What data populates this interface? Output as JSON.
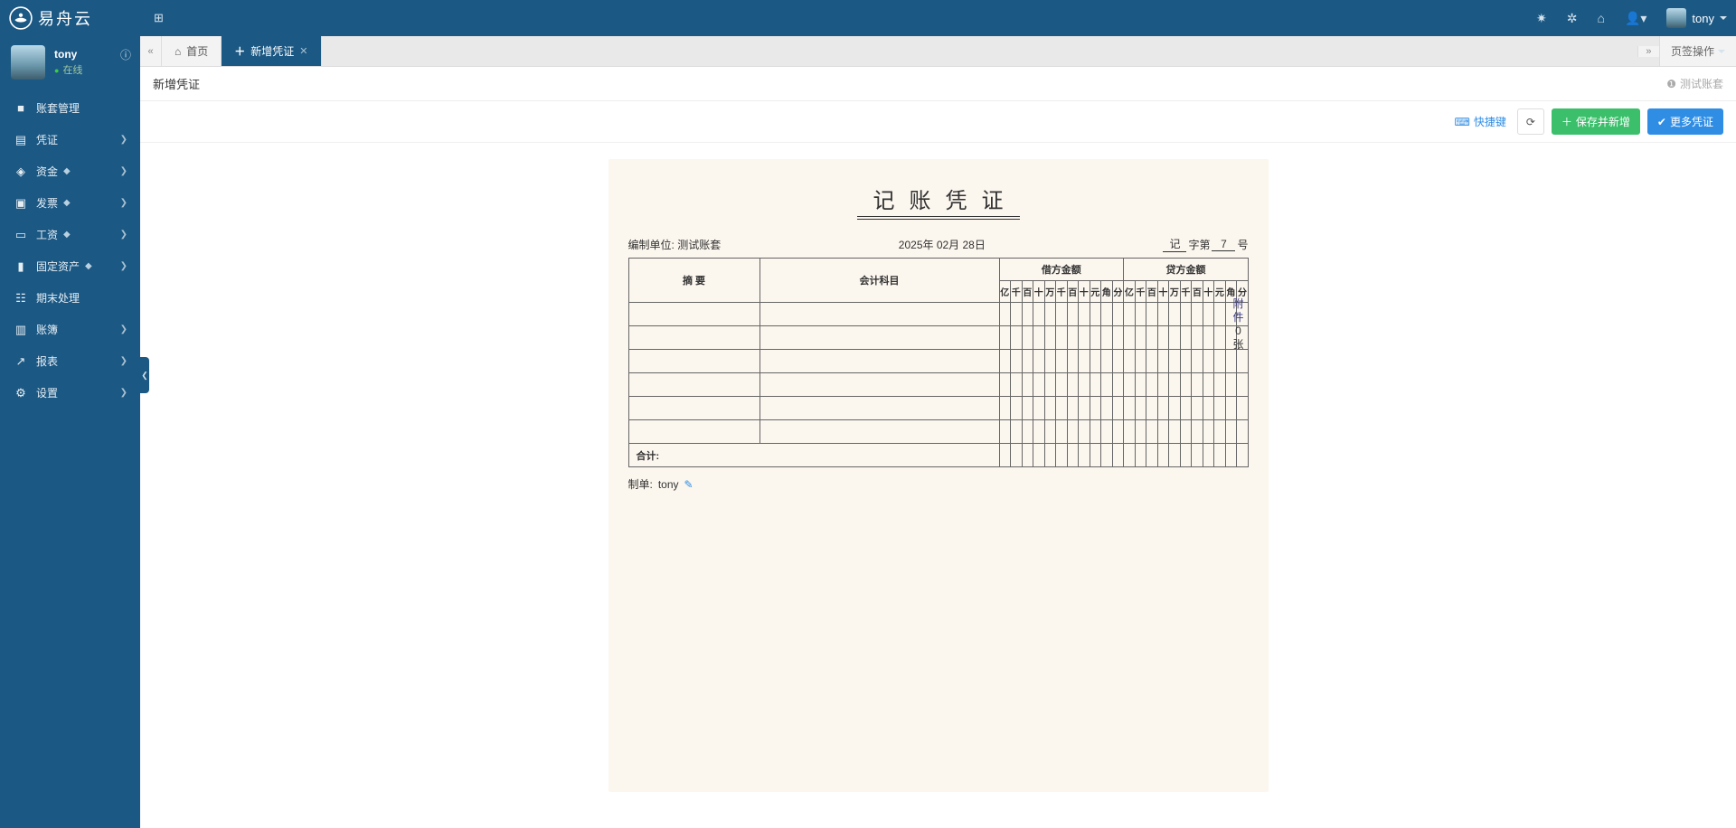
{
  "brand": "易舟云",
  "topbar": {
    "username": "tony"
  },
  "user": {
    "name": "tony",
    "status": "在线"
  },
  "sidebar": [
    {
      "icon": "■",
      "label": "账套管理",
      "hasChildren": false,
      "gem": false
    },
    {
      "icon": "▤",
      "label": "凭证",
      "hasChildren": true,
      "gem": false
    },
    {
      "icon": "◈",
      "label": "资金",
      "hasChildren": true,
      "gem": true
    },
    {
      "icon": "▣",
      "label": "发票",
      "hasChildren": true,
      "gem": true
    },
    {
      "icon": "▭",
      "label": "工资",
      "hasChildren": true,
      "gem": true
    },
    {
      "icon": "▮",
      "label": "固定资产",
      "hasChildren": true,
      "gem": true
    },
    {
      "icon": "☷",
      "label": "期末处理",
      "hasChildren": false,
      "gem": false
    },
    {
      "icon": "▥",
      "label": "账簿",
      "hasChildren": true,
      "gem": false
    },
    {
      "icon": "↗",
      "label": "报表",
      "hasChildren": true,
      "gem": false
    },
    {
      "icon": "⚙",
      "label": "设置",
      "hasChildren": true,
      "gem": false
    }
  ],
  "tabs": {
    "home": "首页",
    "active": "新增凭证",
    "ops": "页签操作"
  },
  "pageHeader": {
    "title": "新增凭证",
    "accountSet": "测试账套"
  },
  "toolbar": {
    "shortcut": "快捷键",
    "save": "保存并新增",
    "more": "更多凭证"
  },
  "voucher": {
    "title": "记账凭证",
    "orgLabel": "编制单位:",
    "orgName": "测试账套",
    "date": "2025年 02月 28日",
    "numWord": "记",
    "numMid": "字第",
    "numValue": "7",
    "numTail": "号",
    "headers": {
      "summary": "摘 要",
      "account": "会计科目",
      "debit": "借方金额",
      "credit": "贷方金额"
    },
    "digits": [
      "亿",
      "千",
      "百",
      "十",
      "万",
      "千",
      "百",
      "十",
      "元",
      "角",
      "分"
    ],
    "rowCount": 6,
    "totalLabel": "合计:",
    "attach": {
      "label": "附件",
      "count": "0",
      "unit": "张"
    },
    "preparedByLabel": "制单:",
    "preparedBy": "tony"
  }
}
